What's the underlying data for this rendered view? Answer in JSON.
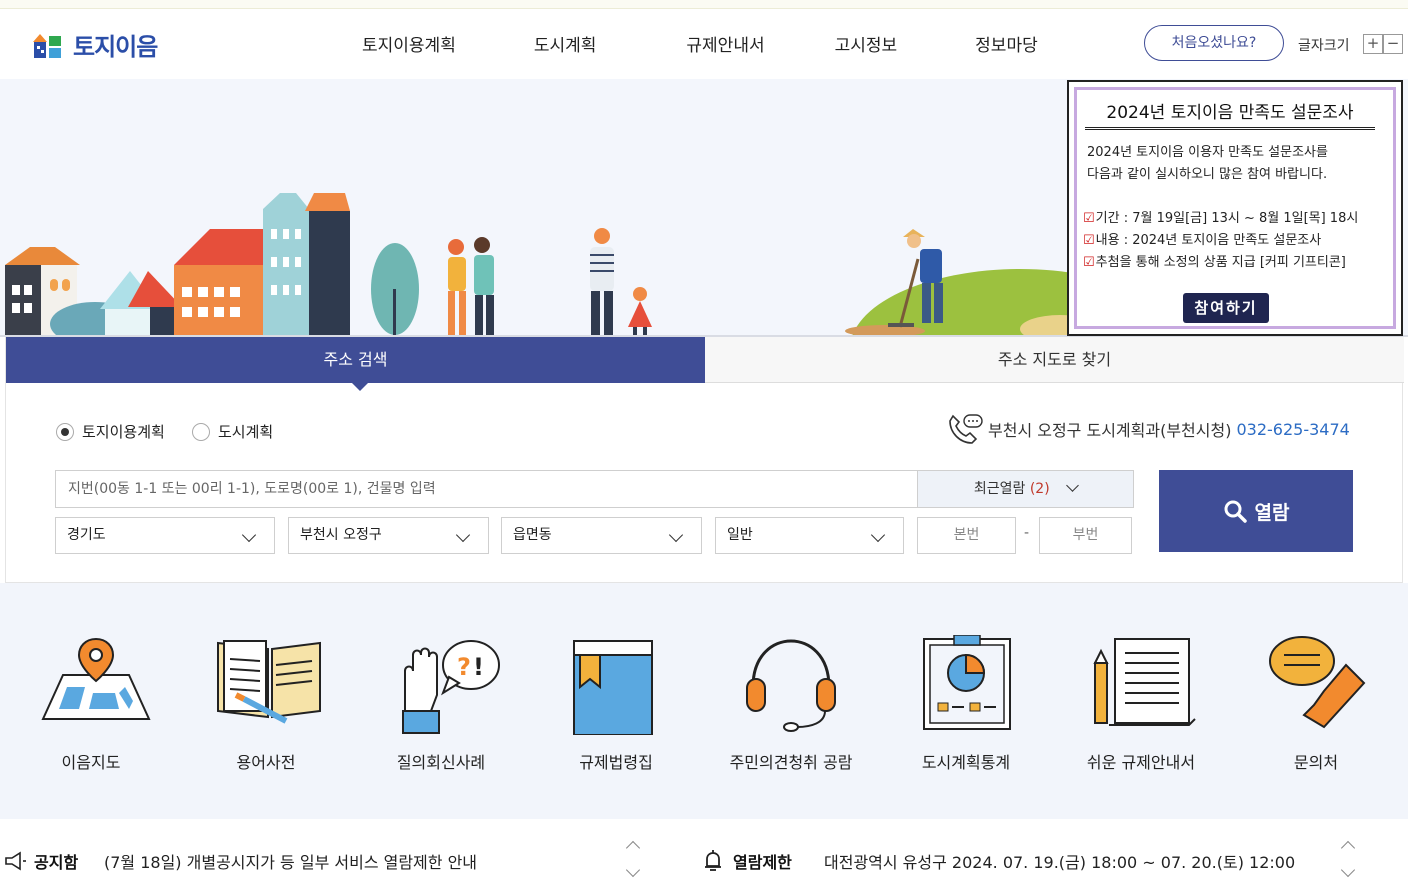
{
  "header": {
    "logo_text": "토지이음",
    "nav": [
      "토지이용계획",
      "도시계획",
      "규제안내서",
      "고시정보",
      "정보마당"
    ],
    "visit_button": "처음오셨나요?",
    "font_size_label": "글자크기",
    "font_plus": "+",
    "font_minus": "−"
  },
  "popup": {
    "title": "2024년 토지이음 만족도 설문조사",
    "desc_line1": "2024년 토지이음 이용자 만족도 설문조사를",
    "desc_line2": "다음과 같이 실시하오니 많은 참여 바랍니다.",
    "items": [
      "기간 : 7월 19일[금] 13시 ~ 8월 1일[목] 18시",
      "내용 : 2024년 토지이음 만족도 설문조사",
      "추첨을 통해 소정의 상품 지급 [커피 기프티콘]"
    ],
    "button": "참여하기"
  },
  "search": {
    "tabs": [
      "주소 검색",
      "주소 지도로 찾기"
    ],
    "radios": [
      {
        "label": "토지이용계획",
        "checked": true
      },
      {
        "label": "도시계획",
        "checked": false
      }
    ],
    "contact_label": "부천시 오정구 도시계획과(부천시청)",
    "contact_phone": "032-625-3474",
    "input_placeholder": "지번(00동 1-1 또는 00리 1-1), 도로명(00로 1), 건물명 입력",
    "recent_label": "최근열람",
    "recent_count": "(2)",
    "selects": [
      "경기도",
      "부천시 오정구",
      "읍면동",
      "일반"
    ],
    "main_no": "본번",
    "sub_no": "부번",
    "submit": "열람"
  },
  "quick_links": [
    "이음지도",
    "용어사전",
    "질의회신사례",
    "규제법령집",
    "주민의견청취 공람",
    "도시계획통계",
    "쉬운 규제안내서",
    "문의처"
  ],
  "notice": {
    "title": "공지함",
    "text": "(7월 18일) 개별공시지가 등 일부 서비스 열람제한 안내"
  },
  "restriction": {
    "title": "열람제한",
    "text": "대전광역시 유성구 2024. 07. 19.(금) 18:00 ~ 07. 20.(토) 12:00"
  },
  "colors": {
    "primary": "#3f4d96",
    "phone": "#2c6cc4",
    "accent_orange": "#f28a2e",
    "accent_blue": "#5aa8e0"
  }
}
